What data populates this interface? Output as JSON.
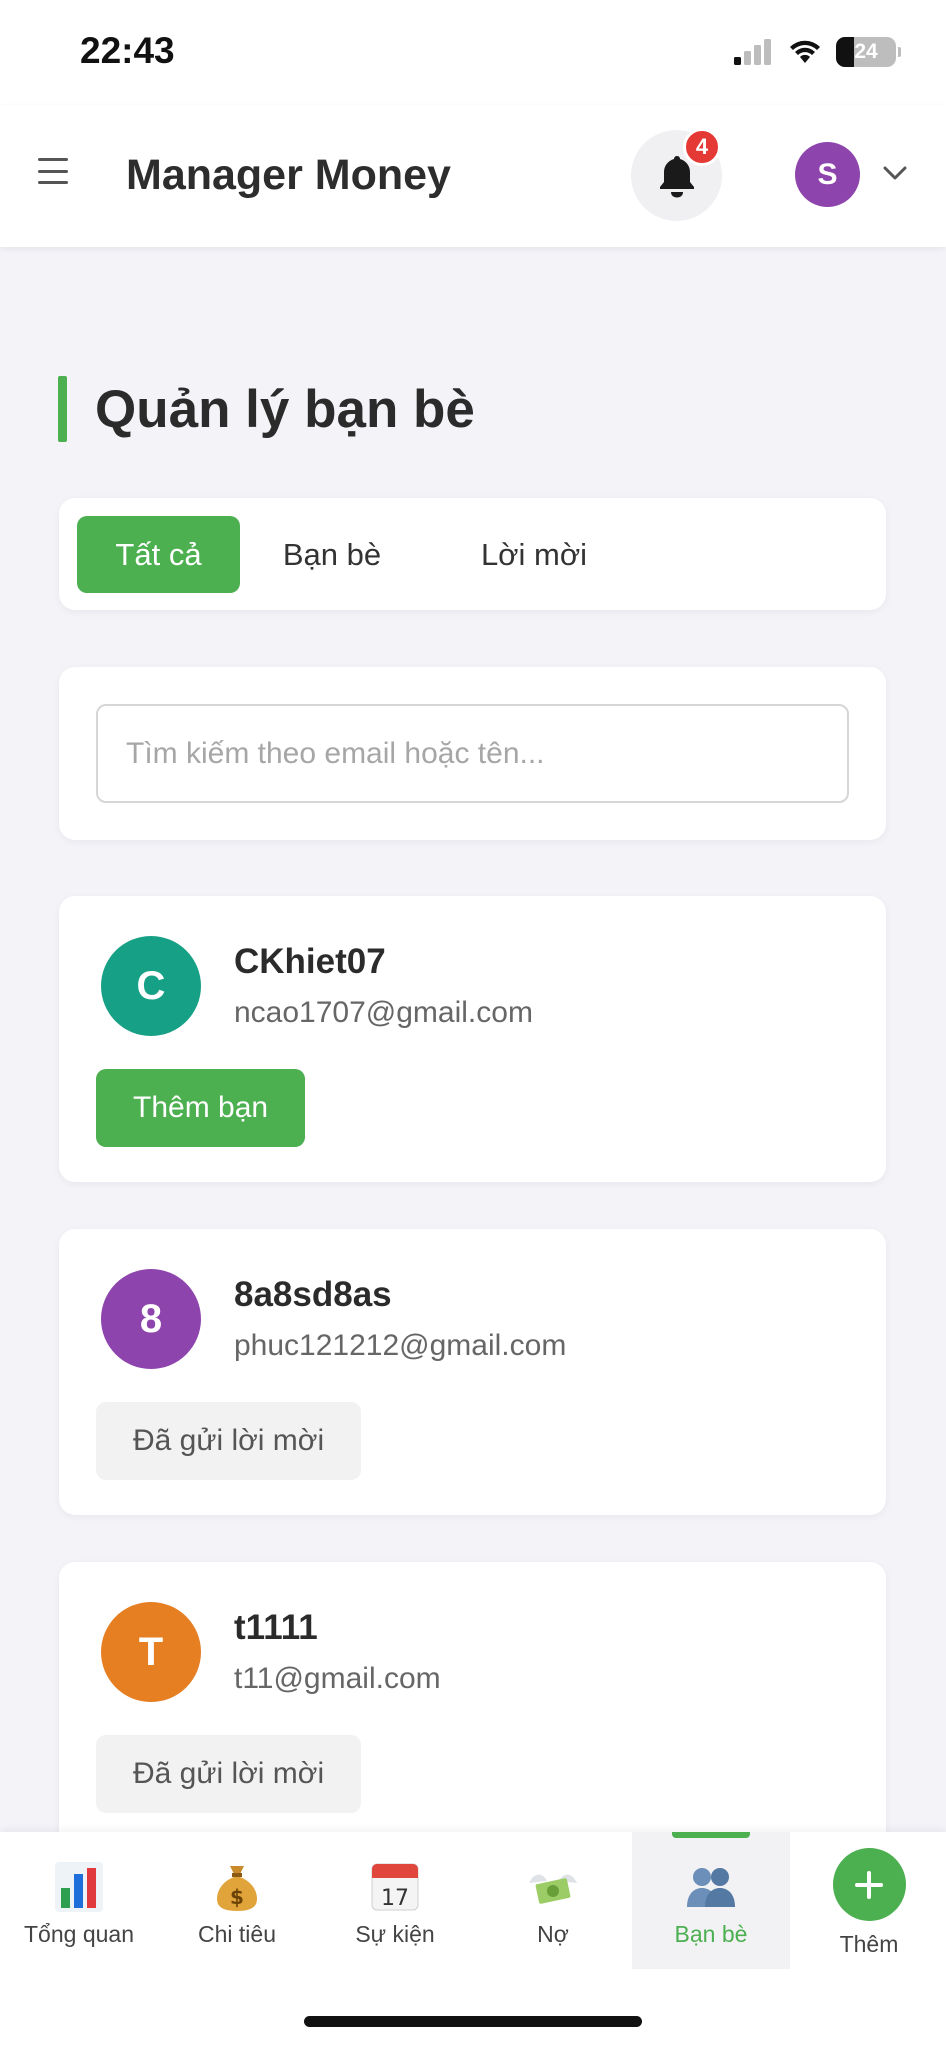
{
  "status_bar": {
    "time": "22:43",
    "battery": "24",
    "icons": [
      "signal-icon",
      "wifi-icon",
      "battery-icon"
    ]
  },
  "header": {
    "title": "Manager Money",
    "notification_count": "4",
    "user_initial": "S",
    "user_avatar_color": "#8e44ad"
  },
  "page": {
    "title": "Quản lý bạn bè"
  },
  "tabs": [
    {
      "label": "Tất cả",
      "active": true
    },
    {
      "label": "Bạn bè",
      "active": false
    },
    {
      "label": "Lời mời",
      "active": false
    }
  ],
  "search": {
    "placeholder": "Tìm kiếm theo email hoặc tên...",
    "value": ""
  },
  "friends": [
    {
      "initial": "C",
      "name": "CKhiet07",
      "email": "ncao1707@gmail.com",
      "avatar_color": "#16a085",
      "action": "Thêm bạn",
      "action_type": "add"
    },
    {
      "initial": "8",
      "name": "8a8sd8as",
      "email": "phuc121212@gmail.com",
      "avatar_color": "#8e44ad",
      "action": "Đã gửi lời mời",
      "action_type": "sent"
    },
    {
      "initial": "T",
      "name": "t1111",
      "email": "t11@gmail.com",
      "avatar_color": "#e67e22",
      "action": "Đã gửi lời mời",
      "action_type": "sent"
    }
  ],
  "bottom_nav": [
    {
      "label": "Tổng quan",
      "icon": "bar-chart-icon",
      "active": false
    },
    {
      "label": "Chi tiêu",
      "icon": "money-bag-icon",
      "active": false
    },
    {
      "label": "Sự kiện",
      "icon": "calendar-icon",
      "active": false
    },
    {
      "label": "Nợ",
      "icon": "money-wings-icon",
      "active": false
    },
    {
      "label": "Bạn bè",
      "icon": "people-icon",
      "active": true
    },
    {
      "label": "Thêm",
      "icon": "plus-icon",
      "active": false
    }
  ],
  "colors": {
    "accent": "#4caf50",
    "badge": "#e53935",
    "background": "#f3f3f8"
  }
}
